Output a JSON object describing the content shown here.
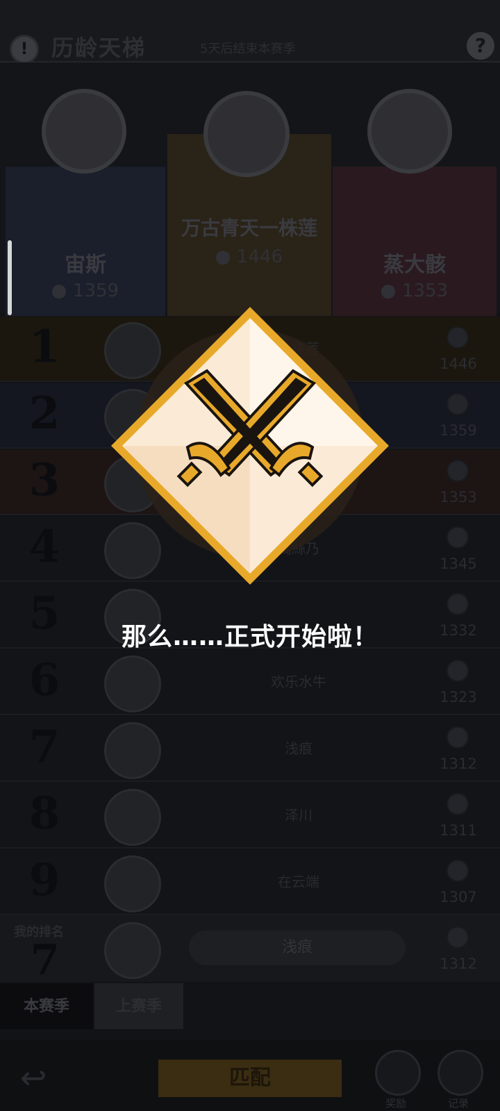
{
  "header": {
    "info_icon": "exclamation-icon",
    "title": "历龄天梯",
    "season_remaining": "5天后结束本赛季",
    "help_icon": "question-icon"
  },
  "podium": [
    {
      "place": "2",
      "name": "宙斯",
      "score": "1359"
    },
    {
      "place": "1",
      "name": "万古青天一株莲",
      "score": "1446"
    },
    {
      "place": "3",
      "name": "蒸大骸",
      "score": "1353"
    }
  ],
  "rankings": [
    {
      "rank": "1",
      "name": "一株莲",
      "score": "1446"
    },
    {
      "rank": "2",
      "name": "",
      "score": "1359"
    },
    {
      "rank": "3",
      "name": "",
      "score": "1353"
    },
    {
      "rank": "4",
      "name": "阔絲乃",
      "score": "1345"
    },
    {
      "rank": "5",
      "name": "",
      "score": "1332"
    },
    {
      "rank": "6",
      "name": "欢乐水牛",
      "score": "1323"
    },
    {
      "rank": "7",
      "name": "浅痕",
      "score": "1312"
    },
    {
      "rank": "8",
      "name": "泽川",
      "score": "1311"
    },
    {
      "rank": "9",
      "name": "在云端",
      "score": "1307"
    }
  ],
  "my_rank": {
    "label": "我的排名",
    "rank": "7",
    "name": "浅痕",
    "score": "1312"
  },
  "tabs": {
    "current": "本赛季",
    "last": "上赛季"
  },
  "bottom": {
    "match_label": "匹配",
    "rewards_label": "奖励",
    "records_label": "记录",
    "back_icon": "back-arrow-icon"
  },
  "overlay": {
    "message": "那么……正式开始啦！",
    "emblem_icon": "crossed-swords-icon"
  },
  "colors": {
    "gold": "#E8A92A",
    "emblem_light": "#FBEBD6",
    "overlay_text": "#FFFFFF"
  }
}
